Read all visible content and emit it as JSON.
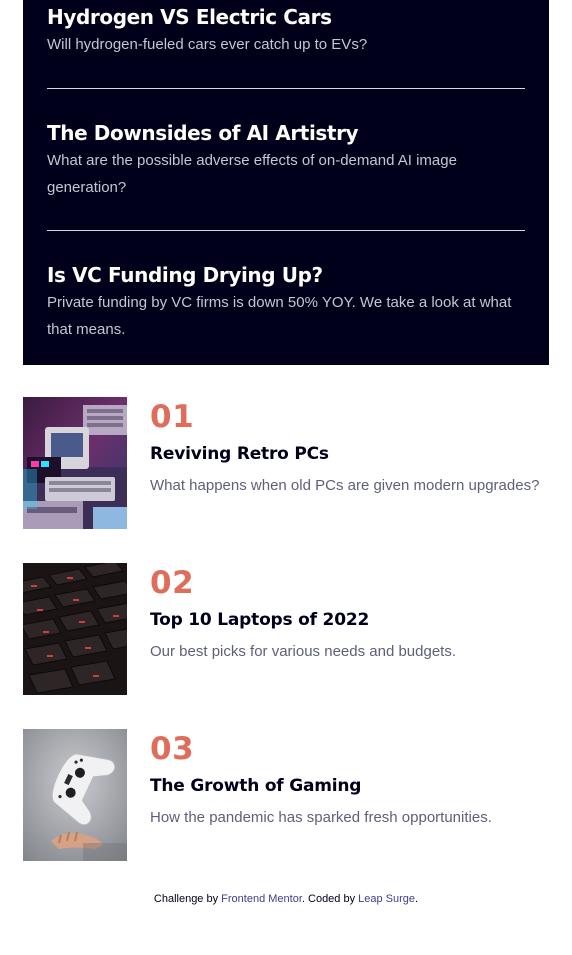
{
  "new_section": {
    "items": [
      {
        "title": "Hydrogen VS Electric Cars",
        "desc": "Will hydrogen-fueled cars ever catch up to EVs?"
      },
      {
        "title": "The Downsides of AI Artistry",
        "desc": "What are the possible adverse effects of on-demand AI image generation?"
      },
      {
        "title": "Is VC Funding Drying Up?",
        "desc": "Private funding by VC firms is down 50% YOY. We take a look at what that means."
      }
    ]
  },
  "articles": [
    {
      "number": "01",
      "title": "Reviving Retro PCs",
      "desc": "What happens when old PCs are given modern upgrades?",
      "image": "retro-pcs-image"
    },
    {
      "number": "02",
      "title": "Top 10 Laptops of 2022",
      "desc": "Our best picks for various needs and budgets.",
      "image": "laptop-keyboard-image"
    },
    {
      "number": "03",
      "title": "The Growth of Gaming",
      "desc": "How the pandemic has sparked fresh opportunities.",
      "image": "game-controller-image"
    }
  ],
  "footer": {
    "prefix": "Challenge by ",
    "challenge_link": "Frontend Mentor",
    "middle": ". Coded by ",
    "coder_link": "Leap Surge",
    "suffix": "."
  },
  "colors": {
    "dark_blue": "#00001a",
    "soft_red": "#e06c5a",
    "grayish_blue": "#5e607a",
    "off_white": "#fffdfa"
  }
}
